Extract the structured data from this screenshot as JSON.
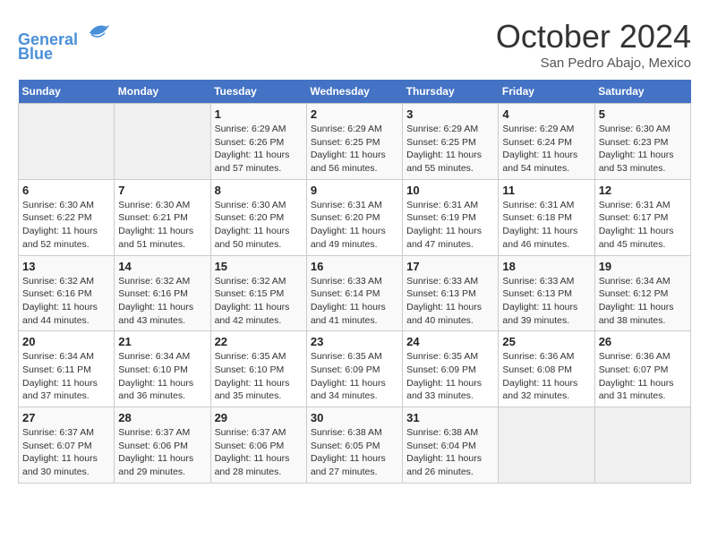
{
  "header": {
    "logo_line1": "General",
    "logo_line2": "Blue",
    "month": "October 2024",
    "location": "San Pedro Abajo, Mexico"
  },
  "weekdays": [
    "Sunday",
    "Monday",
    "Tuesday",
    "Wednesday",
    "Thursday",
    "Friday",
    "Saturday"
  ],
  "weeks": [
    [
      {
        "day": "",
        "empty": true
      },
      {
        "day": "",
        "empty": true
      },
      {
        "day": "1",
        "sunrise": "6:29 AM",
        "sunset": "6:26 PM",
        "daylight": "11 hours and 57 minutes."
      },
      {
        "day": "2",
        "sunrise": "6:29 AM",
        "sunset": "6:25 PM",
        "daylight": "11 hours and 56 minutes."
      },
      {
        "day": "3",
        "sunrise": "6:29 AM",
        "sunset": "6:25 PM",
        "daylight": "11 hours and 55 minutes."
      },
      {
        "day": "4",
        "sunrise": "6:29 AM",
        "sunset": "6:24 PM",
        "daylight": "11 hours and 54 minutes."
      },
      {
        "day": "5",
        "sunrise": "6:30 AM",
        "sunset": "6:23 PM",
        "daylight": "11 hours and 53 minutes."
      }
    ],
    [
      {
        "day": "6",
        "sunrise": "6:30 AM",
        "sunset": "6:22 PM",
        "daylight": "11 hours and 52 minutes."
      },
      {
        "day": "7",
        "sunrise": "6:30 AM",
        "sunset": "6:21 PM",
        "daylight": "11 hours and 51 minutes."
      },
      {
        "day": "8",
        "sunrise": "6:30 AM",
        "sunset": "6:20 PM",
        "daylight": "11 hours and 50 minutes."
      },
      {
        "day": "9",
        "sunrise": "6:31 AM",
        "sunset": "6:20 PM",
        "daylight": "11 hours and 49 minutes."
      },
      {
        "day": "10",
        "sunrise": "6:31 AM",
        "sunset": "6:19 PM",
        "daylight": "11 hours and 47 minutes."
      },
      {
        "day": "11",
        "sunrise": "6:31 AM",
        "sunset": "6:18 PM",
        "daylight": "11 hours and 46 minutes."
      },
      {
        "day": "12",
        "sunrise": "6:31 AM",
        "sunset": "6:17 PM",
        "daylight": "11 hours and 45 minutes."
      }
    ],
    [
      {
        "day": "13",
        "sunrise": "6:32 AM",
        "sunset": "6:16 PM",
        "daylight": "11 hours and 44 minutes."
      },
      {
        "day": "14",
        "sunrise": "6:32 AM",
        "sunset": "6:16 PM",
        "daylight": "11 hours and 43 minutes."
      },
      {
        "day": "15",
        "sunrise": "6:32 AM",
        "sunset": "6:15 PM",
        "daylight": "11 hours and 42 minutes."
      },
      {
        "day": "16",
        "sunrise": "6:33 AM",
        "sunset": "6:14 PM",
        "daylight": "11 hours and 41 minutes."
      },
      {
        "day": "17",
        "sunrise": "6:33 AM",
        "sunset": "6:13 PM",
        "daylight": "11 hours and 40 minutes."
      },
      {
        "day": "18",
        "sunrise": "6:33 AM",
        "sunset": "6:13 PM",
        "daylight": "11 hours and 39 minutes."
      },
      {
        "day": "19",
        "sunrise": "6:34 AM",
        "sunset": "6:12 PM",
        "daylight": "11 hours and 38 minutes."
      }
    ],
    [
      {
        "day": "20",
        "sunrise": "6:34 AM",
        "sunset": "6:11 PM",
        "daylight": "11 hours and 37 minutes."
      },
      {
        "day": "21",
        "sunrise": "6:34 AM",
        "sunset": "6:10 PM",
        "daylight": "11 hours and 36 minutes."
      },
      {
        "day": "22",
        "sunrise": "6:35 AM",
        "sunset": "6:10 PM",
        "daylight": "11 hours and 35 minutes."
      },
      {
        "day": "23",
        "sunrise": "6:35 AM",
        "sunset": "6:09 PM",
        "daylight": "11 hours and 34 minutes."
      },
      {
        "day": "24",
        "sunrise": "6:35 AM",
        "sunset": "6:09 PM",
        "daylight": "11 hours and 33 minutes."
      },
      {
        "day": "25",
        "sunrise": "6:36 AM",
        "sunset": "6:08 PM",
        "daylight": "11 hours and 32 minutes."
      },
      {
        "day": "26",
        "sunrise": "6:36 AM",
        "sunset": "6:07 PM",
        "daylight": "11 hours and 31 minutes."
      }
    ],
    [
      {
        "day": "27",
        "sunrise": "6:37 AM",
        "sunset": "6:07 PM",
        "daylight": "11 hours and 30 minutes."
      },
      {
        "day": "28",
        "sunrise": "6:37 AM",
        "sunset": "6:06 PM",
        "daylight": "11 hours and 29 minutes."
      },
      {
        "day": "29",
        "sunrise": "6:37 AM",
        "sunset": "6:06 PM",
        "daylight": "11 hours and 28 minutes."
      },
      {
        "day": "30",
        "sunrise": "6:38 AM",
        "sunset": "6:05 PM",
        "daylight": "11 hours and 27 minutes."
      },
      {
        "day": "31",
        "sunrise": "6:38 AM",
        "sunset": "6:04 PM",
        "daylight": "11 hours and 26 minutes."
      },
      {
        "day": "",
        "empty": true
      },
      {
        "day": "",
        "empty": true
      }
    ]
  ]
}
